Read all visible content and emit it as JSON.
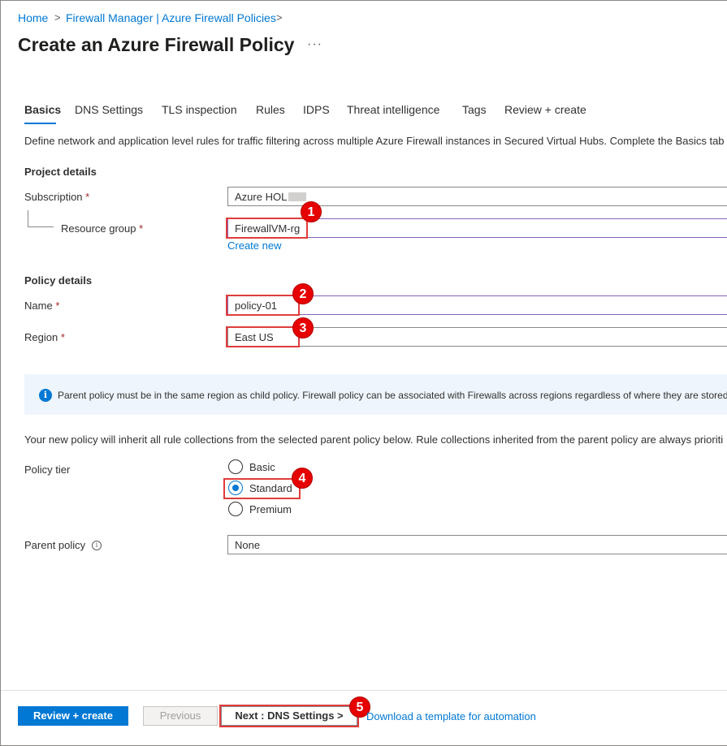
{
  "breadcrumb": {
    "items": [
      "Home",
      "Firewall Manager | Azure Firewall Policies"
    ],
    "separator": ">"
  },
  "page": {
    "title": "Create an Azure Firewall Policy",
    "more_label": "···"
  },
  "tabs": [
    {
      "label": "Basics",
      "active": true
    },
    {
      "label": "DNS Settings",
      "active": false
    },
    {
      "label": "TLS inspection",
      "active": false
    },
    {
      "label": "Rules",
      "active": false
    },
    {
      "label": "IDPS",
      "active": false
    },
    {
      "label": "Threat intelligence",
      "active": false
    },
    {
      "label": "Tags",
      "active": false
    },
    {
      "label": "Review + create",
      "active": false
    }
  ],
  "description": "Define network and application level rules for traffic filtering across multiple Azure Firewall instances in Secured Virtual Hubs. Complete the Basics tab t",
  "project_details": {
    "heading": "Project details",
    "subscription": {
      "label": "Subscription",
      "required": "*",
      "value": "Azure HOL"
    },
    "resource_group": {
      "label": "Resource group",
      "required": "*",
      "value": "FirewallVM-rg",
      "create_new": "Create new"
    }
  },
  "policy_details": {
    "heading": "Policy details",
    "name": {
      "label": "Name",
      "required": "*",
      "value": "policy-01"
    },
    "region": {
      "label": "Region",
      "required": "*",
      "value": "East US"
    }
  },
  "info_banner": {
    "icon": "info-icon",
    "text": "Parent policy must be in the same region as child policy. Firewall policy can be associated with Firewalls across regions regardless of where they are stored."
  },
  "inherit_text": "Your new policy will inherit all rule collections from the selected parent policy below. Rule collections inherited from the parent policy are always prioriti",
  "policy_tier": {
    "label": "Policy tier",
    "options": [
      {
        "label": "Basic",
        "checked": false
      },
      {
        "label": "Standard",
        "checked": true
      },
      {
        "label": "Premium",
        "checked": false
      }
    ]
  },
  "parent_policy": {
    "label": "Parent policy",
    "value": "None"
  },
  "footer": {
    "review_create": "Review + create",
    "previous": "Previous",
    "next": "Next : DNS Settings >",
    "download": "Download a template for automation"
  },
  "annotations": [
    "1",
    "2",
    "3",
    "4",
    "5"
  ],
  "colors": {
    "accent": "#0078d4",
    "highlight": "#e03c3c",
    "badge": "#e60000",
    "required": "#a4262c"
  }
}
